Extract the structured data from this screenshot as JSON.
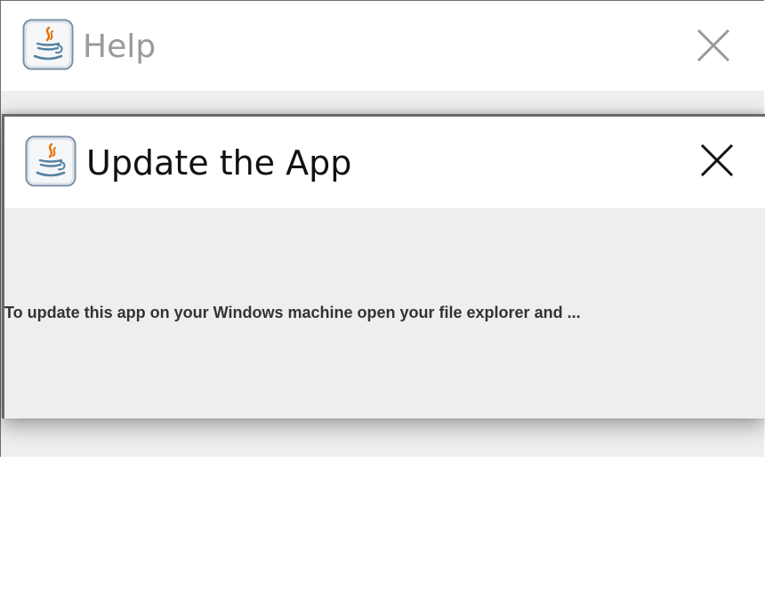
{
  "help_window": {
    "title": "Help",
    "icon": "java-icon",
    "close_icon": "close-icon"
  },
  "update_dialog": {
    "title": "Update the App",
    "icon": "java-icon",
    "close_icon": "close-icon",
    "message": "To update this app on your Windows machine open your file explorer and ..."
  },
  "colors": {
    "java_blue": "#5382a1",
    "java_orange": "#e76f00",
    "inactive_title": "#9a9a9a",
    "active_title": "#111111",
    "dialog_background": "#eeeeee",
    "border": "#6a6a6a"
  }
}
